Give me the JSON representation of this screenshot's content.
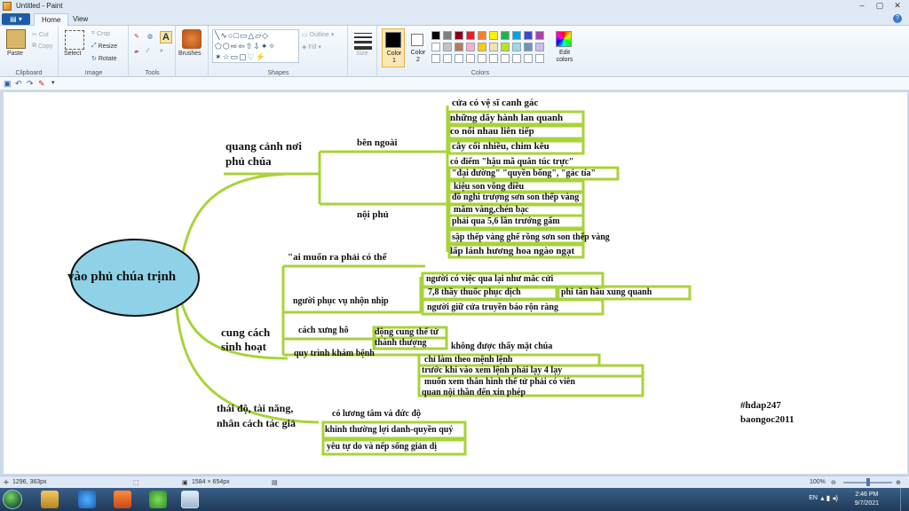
{
  "window": {
    "title": "Untitled - Paint"
  },
  "tabs": [
    "Home",
    "View"
  ],
  "ribbon": {
    "clipboard": {
      "label": "Clipboard",
      "paste": "Paste",
      "cut": "Cut",
      "copy": "Copy"
    },
    "image": {
      "label": "Image",
      "select": "Select",
      "crop": "Crop",
      "resize": "Resize",
      "rotate": "Rotate"
    },
    "tools": {
      "label": "Tools"
    },
    "brushes": {
      "label": "Brushes"
    },
    "shapes": {
      "label": "Shapes",
      "outline": "Outline",
      "fill": "Fill"
    },
    "size": {
      "label": "Size"
    },
    "colors": {
      "label": "Colors",
      "color1": "Color 1",
      "color2": "Color 2",
      "edit": "Edit colors",
      "color1_value": "#000000",
      "color2_value": "#ffffff",
      "palette": [
        "#000000",
        "#7f7f7f",
        "#880015",
        "#ed1c24",
        "#ff7f27",
        "#fff200",
        "#22b14c",
        "#00a2e8",
        "#3f48cc",
        "#a349a4",
        "#ffffff",
        "#c3c3c3",
        "#b97a57",
        "#ffaec9",
        "#ffc90e",
        "#efe4b0",
        "#b5e61d",
        "#99d9ea",
        "#7092be",
        "#c8bfe7",
        "#ffffff",
        "#ffffff",
        "#ffffff",
        "#ffffff",
        "#ffffff",
        "#ffffff",
        "#ffffff",
        "#ffffff",
        "#ffffff",
        "#ffffff"
      ]
    }
  },
  "mindmap": {
    "center": "vào phủ chúa trịnh",
    "b1": {
      "title": "quang cảnh nơi",
      "title2": "phủ chúa",
      "outside": "bên ngoài",
      "inside": "nội phủ",
      "items": [
        "cửa có vệ sĩ canh gác",
        "những dãy hành lan quanh",
        "co nối nhau liên tiếp",
        "cây cối nhiều, chim kêu",
        "có điếm \"hậu mã quân túc trực\"",
        "\"đại đường\" \"quyền bổng\", \"gác tía\"",
        "kiệu son võng điều",
        "đồ nghi trượng sơn son thếp vàng",
        "mâm vàng,chén bạc",
        "phải qua 5,6 lần trướng gấm",
        "sập thếp vàng ghế rồng sơn son thếp vàng",
        "lấp lánh hương hoa ngào ngạt"
      ]
    },
    "b2": {
      "title": "cung cách",
      "title2": "sinh hoạt",
      "quote": "\"ai muốn ra phải có thể",
      "servants": "người phục vụ nhộn nhịp",
      "s1": "người có việc qua lại như mắc cửi",
      "s2": "7,8 thầy thuốc phục dịch",
      "s2b": "phi tần hầu xung quanh",
      "s3": "người giữ cửa truyền báo rộn ràng",
      "address": "cách xưng hô",
      "a1": "động cung thể tử",
      "a2": "thánh thượng",
      "exam": "quy trình khám bệnh",
      "e0": "không được thấy mặt chúa",
      "e1": "chỉ làm theo mệnh lệnh",
      "e2": "trước khi vào xem lệnh phải lạy 4 lạy",
      "e3": "muốn xem thân hình thế tử phải có viên",
      "e4": "quan nội thần đến xin phép"
    },
    "b3": {
      "title": "thái độ, tài năng,",
      "title2": "nhân cách tác giả",
      "t1": "có lương tâm và đức độ",
      "t2": "khinh thường lợi danh-quyền quý",
      "t3": "yêu tự do và nếp sống giản dị"
    },
    "tags": [
      "#hdap247",
      "baongoc2011"
    ]
  },
  "status": {
    "cursor": "1296, 363px",
    "size": "1584 × 654px",
    "zoom": "100%"
  },
  "taskbar": {
    "lang": "EN",
    "time": "2:46 PM",
    "date": "9/7/2021"
  }
}
